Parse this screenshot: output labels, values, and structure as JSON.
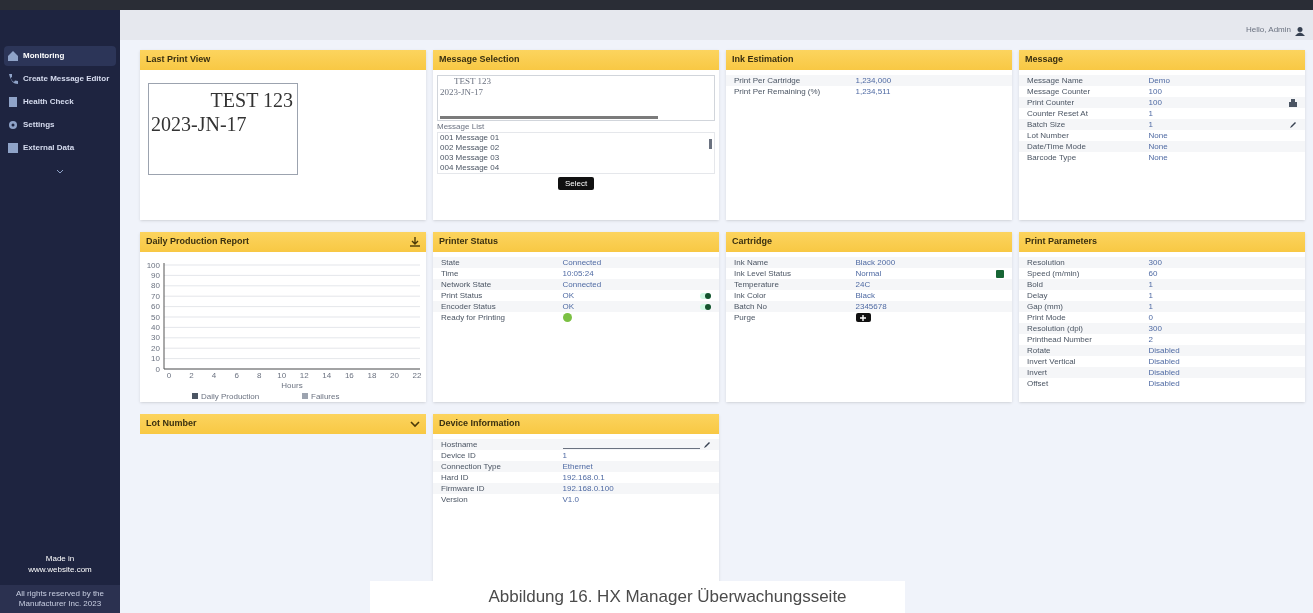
{
  "sidebar": {
    "items": [
      {
        "label": "Monitoring",
        "selected": true
      },
      {
        "label": "Create Message Editor",
        "selected": false
      },
      {
        "label": "Health Check",
        "selected": false
      },
      {
        "label": "Settings",
        "selected": false
      },
      {
        "label": "External Data",
        "selected": false
      }
    ],
    "footer": [
      "Made in",
      "www.website.com"
    ],
    "copyright": "All rights reserved by the Manufacturer Inc. 2023"
  },
  "top_bar": {
    "user": "Hello, Admin"
  },
  "panels": [
    {
      "kind": "print_view",
      "title": "Last Print View",
      "lines": [
        "TEST 123",
        "2023-JN-17"
      ]
    },
    {
      "kind": "message_selection",
      "title": "Message Selection",
      "preview": [
        "TEST 123",
        "2023-JN-17"
      ],
      "list_label": "Message List",
      "items": [
        "001 Message 01",
        "002 Message 02",
        "003 Message 03",
        "004 Message 04"
      ],
      "button": "Select"
    },
    {
      "kind": "kv",
      "title": "Ink Estimation",
      "rows": [
        {
          "label": "Print Per Cartridge",
          "value": "1,234,000"
        },
        {
          "label": "Print Per Remaining (%)",
          "value": "1,234,511"
        }
      ]
    },
    {
      "kind": "kv",
      "title": "Message",
      "rows": [
        {
          "label": "Message Name",
          "value": "Demo"
        },
        {
          "label": "Message Counter",
          "value": "100"
        },
        {
          "label": "Print Counter",
          "value": "100",
          "kind": "printable"
        },
        {
          "label": "Counter Reset At",
          "value": "1"
        },
        {
          "label": "Batch Size",
          "value": "1",
          "kind": "editable"
        },
        {
          "label": "Lot Number",
          "value": "None"
        },
        {
          "label": "Date/Time Mode",
          "value": "None"
        },
        {
          "label": "Barcode Type",
          "value": "None"
        }
      ]
    },
    {
      "kind": "chart",
      "title": "Daily Production Report",
      "chart_data": {
        "type": "line",
        "xlabel": "Hours",
        "grid": true,
        "legend": "bottom",
        "x": [
          "0",
          "2",
          "4",
          "6",
          "8",
          "10",
          "12",
          "14",
          "16",
          "18",
          "20",
          "22"
        ],
        "yticks": [
          0,
          10,
          20,
          30,
          40,
          50,
          60,
          70,
          80,
          90,
          100
        ],
        "ylim": [
          0,
          100
        ],
        "series": [
          {
            "name": "Daily Production",
            "color": "#4b5563",
            "values": [
              null,
              null,
              null,
              null,
              null,
              null,
              null,
              null,
              null,
              null,
              null,
              null
            ]
          },
          {
            "name": "Failures",
            "color": "#9ca3af",
            "values": [
              null,
              null,
              null,
              null,
              null,
              null,
              null,
              null,
              null,
              null,
              null,
              null
            ]
          }
        ]
      }
    },
    {
      "kind": "kv",
      "title": "Printer Status",
      "rows": [
        {
          "label": "State",
          "value": "Connected"
        },
        {
          "label": "Time",
          "value": "10:05:24"
        },
        {
          "label": "Network State",
          "value": "Connected"
        },
        {
          "label": "Print Status",
          "value": "OK",
          "toggle": true
        },
        {
          "label": "Encoder Status",
          "value": "OK",
          "toggle": true
        },
        {
          "label": "Ready for Printing",
          "value": "",
          "kind": "dot",
          "color": "#7bc043"
        }
      ]
    },
    {
      "kind": "kv",
      "title": "Cartridge",
      "rows": [
        {
          "label": "Ink Name",
          "value": "Black 2000"
        },
        {
          "label": "Ink Level Status",
          "value": "Normal",
          "color": "#166534"
        },
        {
          "label": "Temperature",
          "value": "24C"
        },
        {
          "label": "Ink Color",
          "value": "Black"
        },
        {
          "label": "Batch No",
          "value": "2345678"
        },
        {
          "label": "Purge",
          "value": "",
          "kind": "button"
        }
      ]
    },
    {
      "kind": "kv",
      "title": "Print Parameters",
      "rows": [
        {
          "label": "Resolution",
          "value": "300"
        },
        {
          "label": "Speed (m/min)",
          "value": "60"
        },
        {
          "label": "Bold",
          "value": "1"
        },
        {
          "label": "Delay",
          "value": "1"
        },
        {
          "label": "Gap (mm)",
          "value": "1"
        },
        {
          "label": "Print Mode",
          "value": "0"
        },
        {
          "label": "Resolution (dpi)",
          "value": "300"
        },
        {
          "label": "Printhead Number",
          "value": "2"
        },
        {
          "label": "Rotate",
          "value": "Disabled"
        },
        {
          "label": "Invert Vertical",
          "value": "Disabled"
        },
        {
          "label": "Invert",
          "value": "Disabled"
        },
        {
          "label": "Offset",
          "value": "Disabled"
        }
      ]
    },
    {
      "kind": "collapsed",
      "title": "Lot Number"
    },
    {
      "kind": "kv",
      "title": "Device Information",
      "rows": [
        {
          "label": "Hostname",
          "value": "",
          "kind": "input"
        },
        {
          "label": "Device ID",
          "value": "1"
        },
        {
          "label": "Connection Type",
          "value": "Ethernet"
        },
        {
          "label": "Hard ID",
          "value": "192.168.0.1"
        },
        {
          "label": "Firmware ID",
          "value": "192.168.0.100"
        },
        {
          "label": "Version",
          "value": "V1.0"
        }
      ]
    }
  ],
  "caption": "Abbildung 16. HX Manager Überwachungsseite"
}
